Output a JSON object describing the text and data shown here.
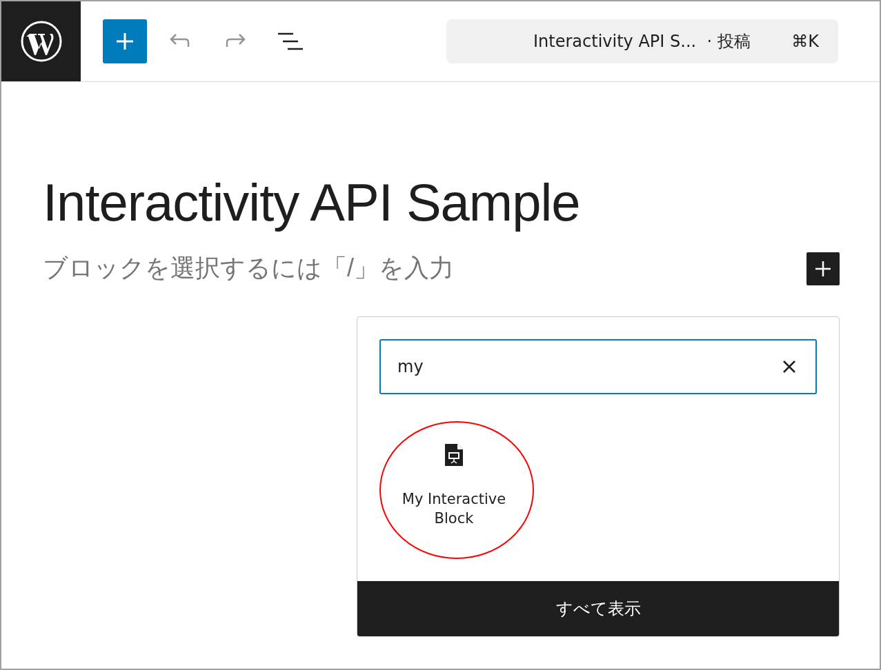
{
  "toolbar": {
    "document_title": "Interactivity API S...",
    "post_type": "· 投稿",
    "shortcut": "⌘K"
  },
  "editor": {
    "title": "Interactivity API Sample",
    "block_placeholder": "ブロックを選択するには「/」を入力"
  },
  "inserter": {
    "search": {
      "value": "my"
    },
    "results": [
      {
        "label": "My Interactive Block",
        "highlighted": true
      }
    ],
    "browse_all": "すべて表示"
  }
}
